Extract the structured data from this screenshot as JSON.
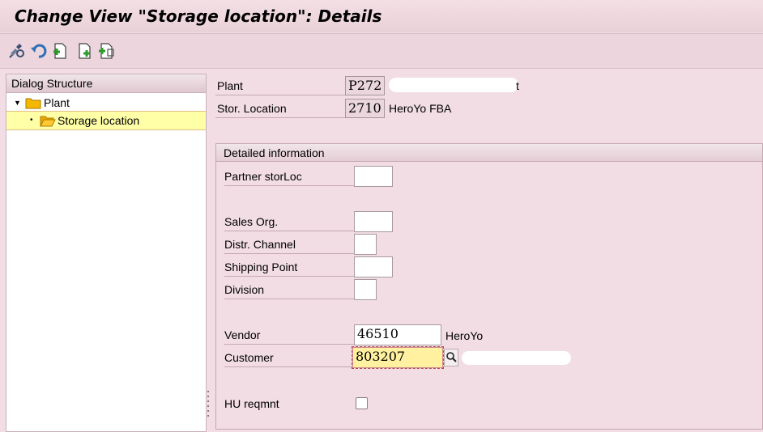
{
  "window": {
    "title": "Change View \"Storage location\": Details"
  },
  "toolbar": {
    "buttons": [
      {
        "name": "display-change-icon"
      },
      {
        "name": "undo-icon"
      },
      {
        "name": "new-entries-icon"
      },
      {
        "name": "copy-as-icon"
      },
      {
        "name": "delimit-icon"
      }
    ]
  },
  "dialog_structure": {
    "header": "Dialog Structure",
    "items": [
      {
        "label": "Plant",
        "expanded": true
      },
      {
        "label": "Storage location",
        "selected": true
      }
    ]
  },
  "key_fields": {
    "plant": {
      "label": "Plant",
      "value": "P272",
      "description_tail": "t"
    },
    "stor_location": {
      "label": "Stor. Location",
      "value": "2710",
      "description": "HeroYo FBA"
    }
  },
  "detail_group": {
    "header": "Detailed information",
    "fields": {
      "partner_storloc": {
        "label": "Partner storLoc",
        "value": ""
      },
      "sales_org": {
        "label": "Sales Org.",
        "value": ""
      },
      "distr_channel": {
        "label": "Distr. Channel",
        "value": ""
      },
      "shipping_point": {
        "label": "Shipping Point",
        "value": ""
      },
      "division": {
        "label": "Division",
        "value": ""
      },
      "vendor": {
        "label": "Vendor",
        "value": "46510",
        "description": "HeroYo"
      },
      "customer": {
        "label": "Customer",
        "value": "803207"
      },
      "hu_reqmnt": {
        "label": "HU reqmnt",
        "checked": false
      }
    }
  }
}
